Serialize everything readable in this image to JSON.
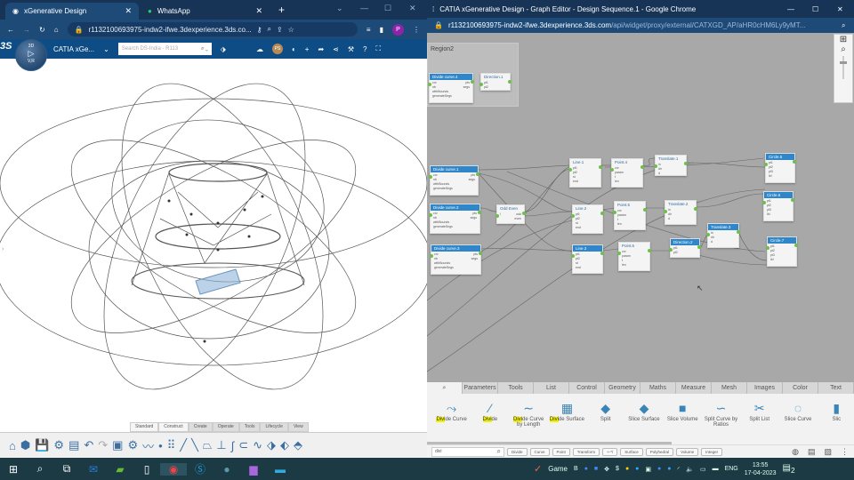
{
  "left_window": {
    "tabs": [
      {
        "title": "xGenerative Design",
        "icon": "3ds-icon"
      },
      {
        "title": "WhatsApp",
        "icon": "whatsapp-icon"
      }
    ],
    "url": "r1132100693975-indw2-ifwe.3dexperience.3ds.co...",
    "profile_initial": "P",
    "app_title": "CATIA xGe...",
    "search_placeholder": "Search DS-India - R113",
    "compass_labels": {
      "top": "3D",
      "bottom": "V,R"
    },
    "user_badge": "PS",
    "toolbar_tabs": [
      "Standard",
      "Construct",
      "Create",
      "Operate",
      "Tools",
      "Lifecycle",
      "View"
    ],
    "active_toolbar_tab": "Standard"
  },
  "right_window": {
    "title": "CATIA xGenerative Design - Graph Editor - Design Sequence.1 - Google Chrome",
    "url_host": "r1132100693975-indw2-ifwe.3dexperience.3ds.com",
    "url_path": "/api/widget/proxy/external/CATXGD_AP/aHR0cHM6Ly9yMT...",
    "region_label": "Region2",
    "nodes": [
      {
        "title": "Divide curve.4",
        "in": [
          "crv",
          "nb",
          "withBounds",
          "generateSegs"
        ],
        "out": [
          "pts",
          "segs"
        ]
      },
      {
        "title": "Direction.1",
        "in": [
          "pt1",
          "pt2"
        ],
        "out": [
          ""
        ]
      },
      {
        "title": "Divide curve.1",
        "in": [
          "crv",
          "nb",
          "withBounds",
          "generateSegs"
        ],
        "out": [
          "pts",
          "segs"
        ]
      },
      {
        "title": "Divide curve.2",
        "in": [
          "crv",
          "nb",
          "withBounds",
          "generateSegs"
        ],
        "out": [
          "pts",
          "segs"
        ]
      },
      {
        "title": "Divide curve.3",
        "in": [
          "crv",
          "nb",
          "withBounds",
          "generateSegs"
        ],
        "out": [
          "pts",
          "segs"
        ]
      },
      {
        "title": "Odd Even",
        "in": [
          "l"
        ],
        "out": [
          "odd",
          "even"
        ]
      },
      {
        "title": "Line.1",
        "in": [
          "pt1",
          "pt2",
          "st",
          "end"
        ],
        "out": [
          ""
        ]
      },
      {
        "title": "Line.2",
        "in": [
          "pt1",
          "pt2",
          "st",
          "end"
        ],
        "out": [
          ""
        ]
      },
      {
        "title": "Line.3",
        "in": [
          "pt1",
          "pt2",
          "st",
          "end"
        ],
        "out": [
          ""
        ]
      },
      {
        "title": "Point.4",
        "in": [
          "crv",
          "param",
          "t",
          "len"
        ],
        "out": [
          ""
        ]
      },
      {
        "title": "Point.5",
        "in": [
          "crv",
          "param",
          "t",
          "len"
        ],
        "out": [
          ""
        ]
      },
      {
        "title": "Point.6",
        "in": [
          "crv",
          "param",
          "t",
          "len"
        ],
        "out": [
          ""
        ]
      },
      {
        "title": "Translate.1",
        "in": [
          "in",
          "dir",
          "d"
        ],
        "out": [
          ""
        ]
      },
      {
        "title": "Translate.2",
        "in": [
          "in",
          "dir",
          "d"
        ],
        "out": [
          ""
        ]
      },
      {
        "title": "Translate.3",
        "in": [
          "in",
          "dir",
          "d"
        ],
        "out": [
          ""
        ]
      },
      {
        "title": "Direction.2",
        "in": [
          "pt1",
          "pt2"
        ],
        "out": [
          ""
        ]
      },
      {
        "title": "Circle.5",
        "in": [
          "pt1",
          "pt2",
          "pt3",
          "lbl"
        ],
        "out": [
          ""
        ]
      },
      {
        "title": "Circle.6",
        "in": [
          "pt1",
          "pt2",
          "pt3",
          "lbl"
        ],
        "out": [
          ""
        ]
      },
      {
        "title": "Circle.7",
        "in": [
          "pt1",
          "pt2",
          "pt3",
          "lbl"
        ],
        "out": [
          ""
        ]
      }
    ],
    "panel_tabs": [
      "Parameters",
      "Tools",
      "List",
      "Control",
      "Geometry",
      "Maths",
      "Measure",
      "Mesh",
      "Images",
      "Color",
      "Text"
    ],
    "tools": [
      {
        "hl": "Divi",
        "rest": "de Curve",
        "icon": "divide-curve-icon"
      },
      {
        "hl": "Divi",
        "rest": "de",
        "icon": "divide-icon"
      },
      {
        "hl": "Divi",
        "rest": "de Curve by Length",
        "icon": "divide-curve-length-icon"
      },
      {
        "hl": "Divi",
        "rest": "de Surface",
        "icon": "divide-surface-icon"
      },
      {
        "hl": "",
        "rest": "Split",
        "icon": "split-icon"
      },
      {
        "hl": "",
        "rest": "Slice Surface",
        "icon": "slice-surface-icon"
      },
      {
        "hl": "",
        "rest": "Slice Volume",
        "icon": "slice-volume-icon"
      },
      {
        "hl": "",
        "rest": "Split Curve by Ratios",
        "icon": "split-curve-ratios-icon"
      },
      {
        "hl": "",
        "rest": "Split List",
        "icon": "split-list-icon"
      },
      {
        "hl": "",
        "rest": "Slice Curve",
        "icon": "slice-curve-icon"
      },
      {
        "hl": "",
        "rest": "Slic",
        "icon": "slice-icon"
      }
    ],
    "search_value": "divi",
    "filter_chips": [
      "Divide",
      "Curve",
      "Point",
      "Transform",
      "+-*/",
      "Surface",
      "Polyhedral",
      "Volume",
      "Integer"
    ]
  },
  "taskbar": {
    "game_label": "Game",
    "language": "ENG",
    "time": "13:55",
    "date": "17-04-2023",
    "notifications": "2"
  }
}
